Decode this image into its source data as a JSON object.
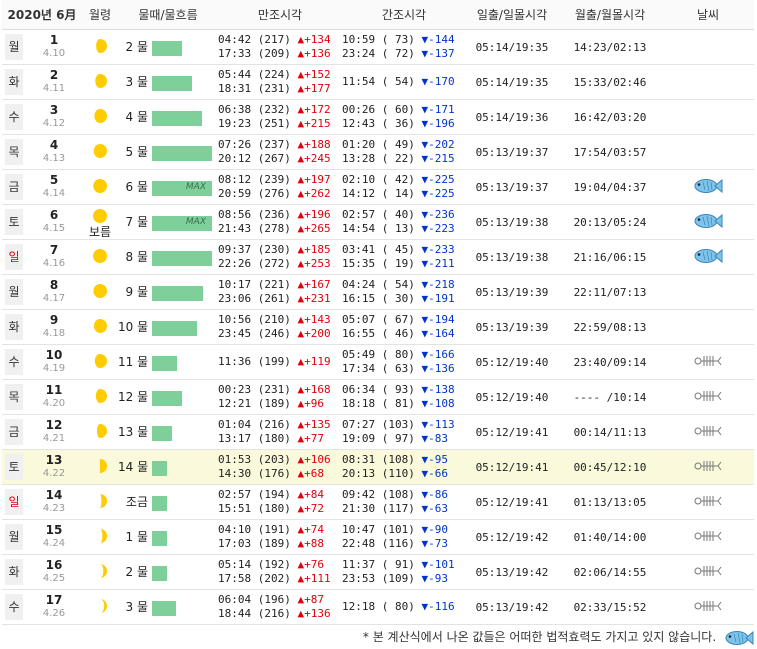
{
  "header": {
    "month": "2020년 6月",
    "moon_age": "월령",
    "tide_flow": "물때/물흐름",
    "high_tide": "만조시각",
    "low_tide": "간조시각",
    "sunrise_sunset": "일출/일몰시각",
    "moonrise_moonset": "월출/월몰시각",
    "weather": "날씨"
  },
  "rows": [
    {
      "dow": "월",
      "sunday": false,
      "date": "1",
      "lunar": "4.10",
      "phase": 0.78,
      "moon_label": "",
      "mul": "2 물",
      "bar": 0.5,
      "max": "",
      "high1": "04:42 (217) ",
      "high1_d": "▲+134",
      "high2": "17:33 (209) ",
      "high2_d": "▲+136",
      "low1": "10:59 ( 73) ",
      "low1_d": "▼-144",
      "low2": "23:24 ( 72) ",
      "low2_d": "▼-137",
      "sun": "05:14/19:35",
      "moonrs": "14:23/02:13",
      "fish": ""
    },
    {
      "dow": "화",
      "sunday": false,
      "date": "2",
      "lunar": "4.11",
      "phase": 0.84,
      "moon_label": "",
      "mul": "3 물",
      "bar": 0.67,
      "max": "",
      "high1": "05:44 (224) ",
      "high1_d": "▲+152",
      "high2": "18:31 (231) ",
      "high2_d": "▲+177",
      "low1": "11:54 ( 54) ",
      "low1_d": "▼-170",
      "low2": "",
      "low2_d": "",
      "sun": "05:14/19:35",
      "moonrs": "15:33/02:46",
      "fish": ""
    },
    {
      "dow": "수",
      "sunday": false,
      "date": "3",
      "lunar": "4.12",
      "phase": 0.9,
      "moon_label": "",
      "mul": "4 물",
      "bar": 0.83,
      "max": "",
      "high1": "06:38 (232) ",
      "high1_d": "▲+172",
      "high2": "19:23 (251) ",
      "high2_d": "▲+215",
      "low1": "00:26 ( 60) ",
      "low1_d": "▼-171",
      "low2": "12:43 ( 36) ",
      "low2_d": "▼-196",
      "sun": "05:14/19:36",
      "moonrs": "16:42/03:20",
      "fish": ""
    },
    {
      "dow": "목",
      "sunday": false,
      "date": "4",
      "lunar": "4.13",
      "phase": 0.95,
      "moon_label": "",
      "mul": "5 물",
      "bar": 1.0,
      "max": "",
      "high1": "07:26 (237) ",
      "high1_d": "▲+188",
      "high2": "20:12 (267) ",
      "high2_d": "▲+245",
      "low1": "01:20 ( 49) ",
      "low1_d": "▼-202",
      "low2": "13:28 ( 22) ",
      "low2_d": "▼-215",
      "sun": "05:13/19:37",
      "moonrs": "17:54/03:57",
      "fish": ""
    },
    {
      "dow": "금",
      "sunday": false,
      "date": "5",
      "lunar": "4.14",
      "phase": 0.98,
      "moon_label": "",
      "mul": "6 물",
      "bar": 1.0,
      "max": "MAX",
      "high1": "08:12 (239) ",
      "high1_d": "▲+197",
      "high2": "20:59 (276) ",
      "high2_d": "▲+262",
      "low1": "02:10 ( 42) ",
      "low1_d": "▼-225",
      "low2": "14:12 ( 14) ",
      "low2_d": "▼-225",
      "sun": "05:13/19:37",
      "moonrs": "19:04/04:37",
      "fish": "good"
    },
    {
      "dow": "토",
      "sunday": false,
      "date": "6",
      "lunar": "4.15",
      "phase": 1.0,
      "moon_label": "보름",
      "mul": "7 물",
      "bar": 1.0,
      "max": "MAX",
      "high1": "08:56 (236) ",
      "high1_d": "▲+196",
      "high2": "21:43 (278) ",
      "high2_d": "▲+265",
      "low1": "02:57 ( 40) ",
      "low1_d": "▼-236",
      "low2": "14:54 ( 13) ",
      "low2_d": "▼-223",
      "sun": "05:13/19:38",
      "moonrs": "20:13/05:24",
      "fish": "good"
    },
    {
      "dow": "일",
      "sunday": true,
      "date": "7",
      "lunar": "4.16",
      "phase": 1.0,
      "moon_label": "",
      "mul": "8 물",
      "bar": 1.0,
      "max": "",
      "high1": "09:37 (230) ",
      "high1_d": "▲+185",
      "high2": "22:26 (272) ",
      "high2_d": "▲+253",
      "low1": "03:41 ( 45) ",
      "low1_d": "▼-233",
      "low2": "15:35 ( 19) ",
      "low2_d": "▼-211",
      "sun": "05:13/19:38",
      "moonrs": "21:16/06:15",
      "fish": "good"
    },
    {
      "dow": "월",
      "sunday": false,
      "date": "8",
      "lunar": "4.17",
      "phase": 0.97,
      "moon_label": "",
      "mul": "9 물",
      "bar": 0.85,
      "max": "",
      "high1": "10:17 (221) ",
      "high1_d": "▲+167",
      "high2": "23:06 (261) ",
      "high2_d": "▲+231",
      "low1": "04:24 ( 54) ",
      "low1_d": "▼-218",
      "low2": "16:15 ( 30) ",
      "low2_d": "▼-191",
      "sun": "05:13/19:39",
      "moonrs": "22:11/07:13",
      "fish": ""
    },
    {
      "dow": "화",
      "sunday": false,
      "date": "9",
      "lunar": "4.18",
      "phase": 0.93,
      "moon_label": "",
      "mul": "10 물",
      "bar": 0.75,
      "max": "",
      "high1": "10:56 (210) ",
      "high1_d": "▲+143",
      "high2": "23:45 (246) ",
      "high2_d": "▲+200",
      "low1": "05:07 ( 67) ",
      "low1_d": "▼-194",
      "low2": "16:55 ( 46) ",
      "low2_d": "▼-164",
      "sun": "05:13/19:39",
      "moonrs": "22:59/08:13",
      "fish": ""
    },
    {
      "dow": "수",
      "sunday": false,
      "date": "10",
      "lunar": "4.19",
      "phase": 0.87,
      "moon_label": "",
      "mul": "11 물",
      "bar": 0.42,
      "max": "",
      "high1": "11:36 (199) ",
      "high1_d": "▲+119",
      "high2": "",
      "high2_d": "",
      "low1": "05:49 ( 80) ",
      "low1_d": "▼-166",
      "low2": "17:34 ( 63) ",
      "low2_d": "▼-136",
      "sun": "05:12/19:40",
      "moonrs": "23:40/09:14",
      "fish": "bone"
    },
    {
      "dow": "목",
      "sunday": false,
      "date": "11",
      "lunar": "4.20",
      "phase": 0.8,
      "moon_label": "",
      "mul": "12 물",
      "bar": 0.5,
      "max": "",
      "high1": "00:23 (231) ",
      "high1_d": "▲+168",
      "high2": "12:21 (189) ",
      "high2_d": "▲+96",
      "low1": "06:34 ( 93) ",
      "low1_d": "▼-138",
      "low2": "18:18 ( 81) ",
      "low2_d": "▼-108",
      "sun": "05:12/19:40",
      "moonrs": "---- /10:14",
      "fish": "bone"
    },
    {
      "dow": "금",
      "sunday": false,
      "date": "12",
      "lunar": "4.21",
      "phase": 0.72,
      "moon_label": "",
      "mul": "13 물",
      "bar": 0.33,
      "max": "",
      "high1": "01:04 (216) ",
      "high1_d": "▲+135",
      "high2": "13:17 (180) ",
      "high2_d": "▲+77",
      "low1": "07:27 (103) ",
      "low1_d": "▼-113",
      "low2": "19:09 ( 97) ",
      "low2_d": "▼-83",
      "sun": "05:12/19:41",
      "moonrs": "00:14/11:13",
      "fish": "bone"
    },
    {
      "dow": "토",
      "sunday": false,
      "date": "13",
      "lunar": "4.22",
      "phase": 0.5,
      "moon_label": "",
      "mul": "14 물",
      "bar": 0.25,
      "max": "",
      "high1": "01:53 (203) ",
      "high1_d": "▲+106",
      "high2": "14:30 (176) ",
      "high2_d": "▲+68",
      "low1": "08:31 (108) ",
      "low1_d": "▼-95",
      "low2": "20:13 (110) ",
      "low2_d": "▼-66",
      "sun": "05:12/19:41",
      "moonrs": "00:45/12:10",
      "fish": "bone",
      "highlight": true
    },
    {
      "dow": "일",
      "sunday": true,
      "date": "14",
      "lunar": "4.23",
      "phase": 0.4,
      "moon_label": "",
      "mul": "조금",
      "bar": 0.25,
      "max": "",
      "high1": "02:57 (194) ",
      "high1_d": "▲+84",
      "high2": "15:51 (180) ",
      "high2_d": "▲+72",
      "low1": "09:42 (108) ",
      "low1_d": "▼-86",
      "low2": "21:30 (117) ",
      "low2_d": "▼-63",
      "sun": "05:12/19:41",
      "moonrs": "01:13/13:05",
      "fish": "bone"
    },
    {
      "dow": "월",
      "sunday": false,
      "date": "15",
      "lunar": "4.24",
      "phase": 0.33,
      "moon_label": "",
      "mul": "1 물",
      "bar": 0.25,
      "max": "",
      "high1": "04:10 (191) ",
      "high1_d": "▲+74",
      "high2": "17:03 (189) ",
      "high2_d": "▲+88",
      "low1": "10:47 (101) ",
      "low1_d": "▼-90",
      "low2": "22:48 (116) ",
      "low2_d": "▼-73",
      "sun": "05:12/19:42",
      "moonrs": "01:40/14:00",
      "fish": "bone"
    },
    {
      "dow": "화",
      "sunday": false,
      "date": "16",
      "lunar": "4.25",
      "phase": 0.26,
      "moon_label": "",
      "mul": "2 물",
      "bar": 0.25,
      "max": "",
      "high1": "05:14 (192) ",
      "high1_d": "▲+76",
      "high2": "17:58 (202) ",
      "high2_d": "▲+111",
      "low1": "11:37 ( 91) ",
      "low1_d": "▼-101",
      "low2": "23:53 (109) ",
      "low2_d": "▼-93",
      "sun": "05:13/19:42",
      "moonrs": "02:06/14:55",
      "fish": "bone"
    },
    {
      "dow": "수",
      "sunday": false,
      "date": "17",
      "lunar": "4.26",
      "phase": 0.2,
      "moon_label": "",
      "mul": "3 물",
      "bar": 0.4,
      "max": "",
      "high1": "06:04 (196) ",
      "high1_d": "▲+87",
      "high2": "18:44 (216) ",
      "high2_d": "▲+136",
      "low1": "12:18 ( 80) ",
      "low1_d": "▼-116",
      "low2": "",
      "low2_d": "",
      "sun": "05:13/19:42",
      "moonrs": "02:33/15:52",
      "fish": "bone"
    }
  ],
  "footer": {
    "note": "* 본 계산식에서 나온 값들은 어떠한 법적효력도 가지고 있지 않습니다."
  },
  "colors": {
    "bar": "#7fcf9b",
    "up": "#e0000b",
    "down": "#0033cc",
    "highlight": "#fbf9dc"
  },
  "icons": {
    "good_fishing": "fish-icon",
    "poor_fishing": "fish-bone-icon"
  }
}
